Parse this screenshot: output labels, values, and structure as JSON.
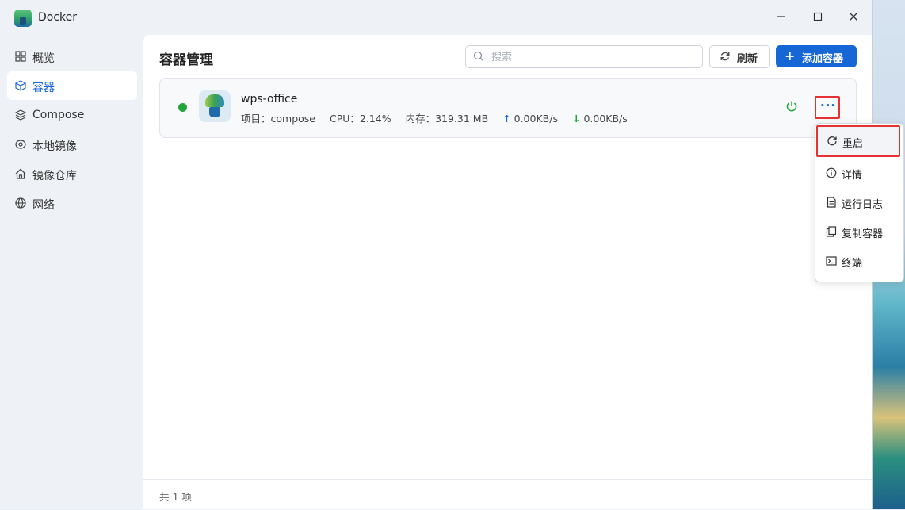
{
  "window": {
    "title": "Docker",
    "minimize": "—",
    "maximize": "□",
    "close": "✕"
  },
  "sidebar": {
    "items": [
      {
        "label": "概览",
        "icon": "grid-icon"
      },
      {
        "label": "容器",
        "icon": "cube-icon",
        "active": true
      },
      {
        "label": "Compose",
        "icon": "layers-icon"
      },
      {
        "label": "本地镜像",
        "icon": "disc-icon"
      },
      {
        "label": "镜像仓库",
        "icon": "house-icon"
      },
      {
        "label": "网络",
        "icon": "globe-icon"
      }
    ]
  },
  "main": {
    "title": "容器管理",
    "search_placeholder": "搜索",
    "refresh_label": "刷新",
    "add_label": "添加容器",
    "add_icon": "+"
  },
  "container": {
    "name": "wps-office",
    "project": "项目：compose",
    "cpu": "CPU：2.14%",
    "memory": "内存：319.31 MB",
    "upload": "0.00KB/s",
    "download": "0.00KB/s",
    "status_color": "#22a63a"
  },
  "menu": {
    "items": [
      {
        "label": "重启",
        "icon": "restart-icon"
      },
      {
        "label": "详情",
        "icon": "info-icon"
      },
      {
        "label": "运行日志",
        "icon": "log-icon"
      },
      {
        "label": "复制容器",
        "icon": "copy-icon"
      },
      {
        "label": "终端",
        "icon": "terminal-icon"
      }
    ]
  },
  "footer": {
    "count": "共 1 项"
  },
  "colors": {
    "accent": "#1766d6",
    "highlight": "#e43232"
  }
}
